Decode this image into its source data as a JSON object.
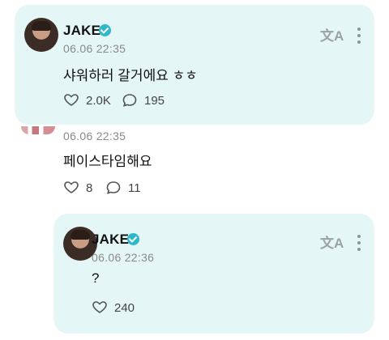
{
  "posts": [
    {
      "username": "JAKE",
      "timestamp": "06.06 22:35",
      "message": "샤워하러 갈거에요 ㅎㅎ",
      "likes": "2.0K",
      "comments": "195",
      "icons": {
        "translate": "文A",
        "more": "more-vertical-icon",
        "like": "heart-outline-icon",
        "comment": "comment-bubble-icon",
        "verified": "verified-badge-icon"
      }
    },
    {
      "timestamp": "06.06 22:35",
      "message": "페이스타임해요",
      "likes": "8",
      "comments": "11"
    },
    {
      "username": "JAKE",
      "timestamp": "06.06 22:36",
      "message": "?",
      "likes": "240",
      "icons": {
        "translate": "文A"
      }
    }
  ],
  "colors": {
    "card_bg": "#e4f6f5",
    "verified": "#2fb8c9",
    "timestamp": "#8a8a8a"
  }
}
